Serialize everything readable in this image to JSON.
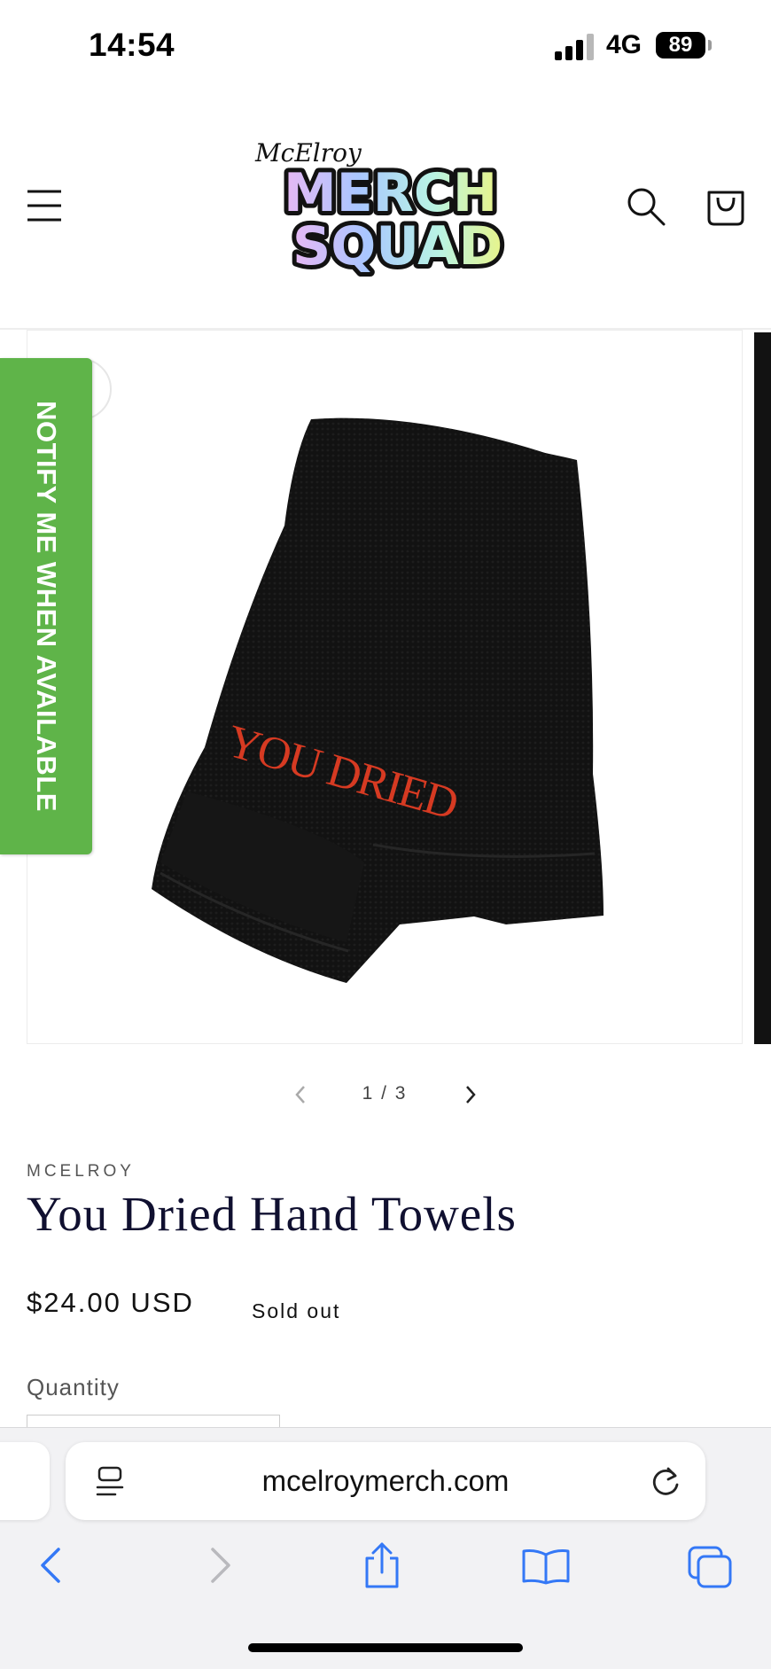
{
  "status_bar": {
    "time": "14:54",
    "network": "4G",
    "battery": "89"
  },
  "header": {
    "logo_small_text": "McElroy",
    "logo_line1": "MERCH",
    "logo_line2": "SQUAD"
  },
  "notify": {
    "label": "NOTIFY ME WHEN AVAILABLE",
    "color": "#5fb449"
  },
  "product_image": {
    "embroidery": "YOU DRIED",
    "embroidery_color": "#d63a22"
  },
  "slider": {
    "counter": "1 / 3"
  },
  "product": {
    "vendor": "MCELROY",
    "title": "You Dried Hand Towels",
    "price": "$24.00 USD",
    "status": "Sold out",
    "quantity_label": "Quantity"
  },
  "browser": {
    "url": "mcelroymerch.com",
    "accent": "#3478f6"
  }
}
